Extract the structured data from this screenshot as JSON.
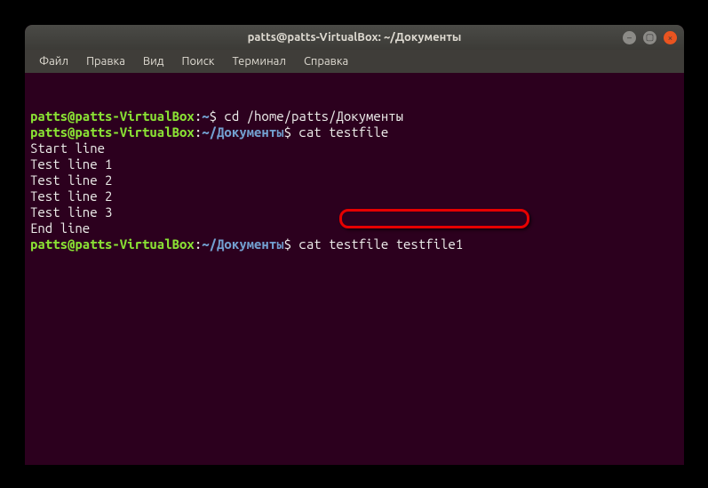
{
  "titlebar": {
    "title": "patts@patts-VirtualBox: ~/Документы"
  },
  "menubar": {
    "items": [
      "Файл",
      "Правка",
      "Вид",
      "Поиск",
      "Терминал",
      "Справка"
    ]
  },
  "terminal": {
    "lines": [
      {
        "type": "prompt",
        "user": "patts@patts-VirtualBox",
        "colon": ":",
        "path": "~",
        "dollar": "$",
        "cmd": " cd /home/patts/Документы"
      },
      {
        "type": "prompt",
        "user": "patts@patts-VirtualBox",
        "colon": ":",
        "path": "~/Документы",
        "dollar": "$",
        "cmd": " cat testfile"
      },
      {
        "type": "output",
        "text": "Start line"
      },
      {
        "type": "output",
        "text": "Test line 1"
      },
      {
        "type": "output",
        "text": "Test line 2"
      },
      {
        "type": "output",
        "text": "Test line 2"
      },
      {
        "type": "output",
        "text": "Test line 3"
      },
      {
        "type": "output",
        "text": "End line"
      },
      {
        "type": "prompt",
        "user": "patts@patts-VirtualBox",
        "colon": ":",
        "path": "~/Документы",
        "dollar": "$",
        "cmd": " cat testfile testfile1"
      }
    ]
  },
  "highlight": {
    "target_cmd": "cat testfile testfile1"
  }
}
